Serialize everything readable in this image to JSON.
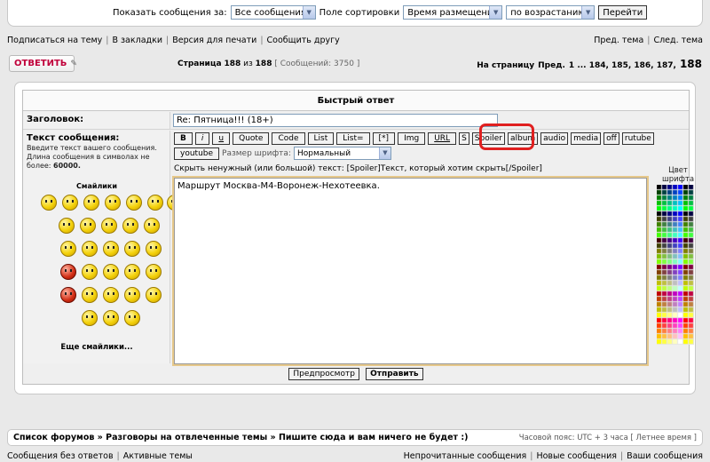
{
  "filter": {
    "show_label": "Показать сообщения за:",
    "show_value": "Все сообщения",
    "sort_label": "Поле сортировки",
    "sort_value": "Время размещения",
    "order_value": "по возрастанию",
    "go_label": "Перейти"
  },
  "topic_links": {
    "subscribe": "Подписаться на тему",
    "bookmark": "В закладки",
    "print": "Версия для печати",
    "tell_friend": "Сообщить другу",
    "prev": "Пред. тема",
    "next": "След. тема"
  },
  "reply_button": "ОТВЕТИТЬ",
  "pagination": {
    "page_label": "Страница",
    "current": "188",
    "of": "из",
    "total": "188",
    "messages": "[ Сообщений: 3750 ]",
    "goto_label": "На страницу",
    "prev": "Пред.",
    "pages": "1 ... 184, 185, 186, 187,",
    "last": "188"
  },
  "quick_reply": {
    "title": "Быстрый ответ",
    "subject_label": "Заголовок:",
    "subject_value": "Re: Пятница!!! (18+)",
    "message_label": "Текст сообщения:",
    "message_hint": "Введите текст вашего сообщения. Длина сообщения в символах не более:",
    "message_max": "60000.",
    "smilies_title": "Смайлики",
    "more_smilies": "Еще смайлики...",
    "font_size_label": "Размер шрифта:",
    "font_size_value": "Нормальный",
    "spoiler_hint": "Скрыть ненужный (или большой) текст: [Spoiler]Текст, который хотим скрыть[/Spoiler]",
    "message_text": "Маршрут Москва-М4-Воронеж-Нехотеевка.",
    "color_title": "Цвет шрифта",
    "preview_label": "Предпросмотр",
    "submit_label": "Отправить"
  },
  "bbcode": [
    "B",
    "i",
    "u",
    "Quote",
    "Code",
    "List",
    "List=",
    "[*]",
    "Img",
    "URL",
    "S",
    "Spoiler",
    "album",
    "audio",
    "media",
    "off",
    "rutube",
    "youtube"
  ],
  "breadcrumb": {
    "path": "Список форумов » Разговоры на отвлеченные темы » Пишите сюда и вам ничего не будет :)",
    "timezone": "Часовой пояс: UTC + 3 часа [ Летнее время ]"
  },
  "footer_links": {
    "unanswered": "Сообщения без ответов",
    "active": "Активные темы",
    "unread": "Непрочитанные сообщения",
    "new": "Новые сообщения",
    "yours": "Ваши сообщения"
  },
  "colors": {
    "accent_red": "#c0003a",
    "highlight": "#e02020"
  }
}
